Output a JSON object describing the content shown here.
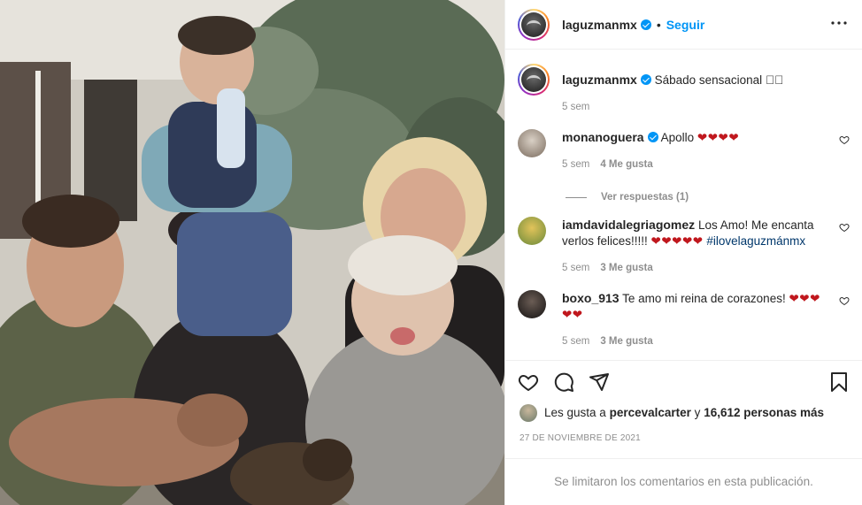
{
  "post": {
    "username": "laguzmanmx",
    "separator": "•",
    "follow_label": "Seguir",
    "more_label": "•••",
    "caption": "Sábado sensacional",
    "caption_emoji": "🏻🏻",
    "caption_time": "5 sem"
  },
  "comments": [
    {
      "username": "monanoguera",
      "verified": true,
      "text": "Apollo",
      "hearts": "❤❤❤❤",
      "time": "5 sem",
      "likes": "4 Me gusta",
      "replies": "Ver respuestas (1)"
    },
    {
      "username": "iamdavidalegriagomez",
      "verified": false,
      "text": "Los Amo! Me encanta verlos felices!!!!!",
      "hearts": "❤❤❤❤❤",
      "hashtag": "#ilovelaguzmánmx",
      "time": "5 sem",
      "likes": "3 Me gusta"
    },
    {
      "username": "boxo_913",
      "verified": false,
      "text": "Te amo mi reina de corazones!",
      "hearts": "❤❤❤",
      "hearts2": "❤❤",
      "time": "5 sem",
      "likes": "3 Me gusta"
    }
  ],
  "likes": {
    "prefix": "Les gusta a",
    "user": "percevalcarter",
    "middle": "y",
    "count": "16,612 personas más"
  },
  "date": "27 DE NOVIEMBRE DE 2021",
  "comments_limited": "Se limitaron los comentarios en esta publicación.",
  "icons": [
    "heart-icon",
    "comment-icon",
    "share-icon",
    "bookmark-icon",
    "verified-icon",
    "more-options-icon"
  ],
  "colors": {
    "accent": "#0095f6",
    "text": "#262626",
    "muted": "#8e8e8e",
    "heart": "#c0171d"
  }
}
